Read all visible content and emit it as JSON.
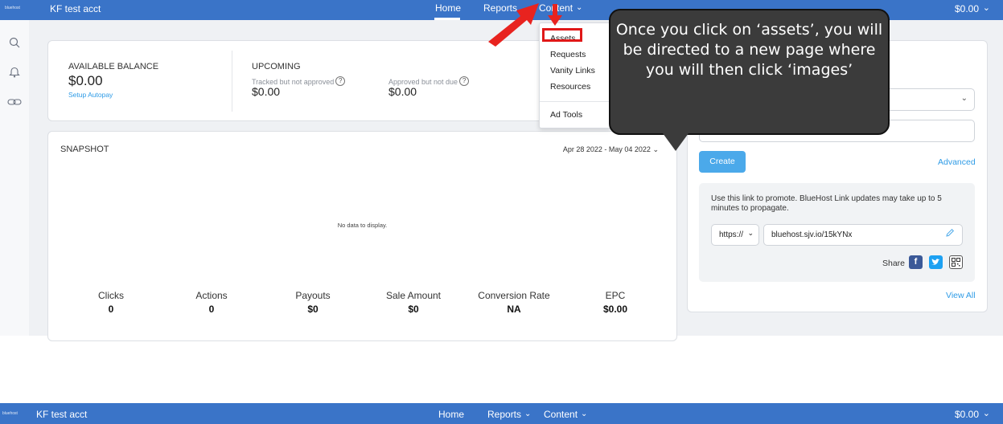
{
  "topbar": {
    "logo_text": "bluehost",
    "account": "KF test acct",
    "nav": [
      "Home",
      "Reports",
      "Content"
    ],
    "balance": "$0.00"
  },
  "balance_card": {
    "available_label": "AVAILABLE BALANCE",
    "available_value": "$0.00",
    "autopay_link": "Setup Autopay",
    "upcoming_label": "UPCOMING",
    "tracked_label": "Tracked but not approved",
    "tracked_value": "$0.00",
    "approved_label": "Approved but not due",
    "approved_value": "$0.00"
  },
  "snapshot": {
    "title": "SNAPSHOT",
    "date_range": "Apr 28 2022 - May 04 2022",
    "empty_message": "No data to display.",
    "stats": [
      {
        "label": "Clicks",
        "value": "0"
      },
      {
        "label": "Actions",
        "value": "0"
      },
      {
        "label": "Payouts",
        "value": "$0"
      },
      {
        "label": "Sale Amount",
        "value": "$0"
      },
      {
        "label": "Conversion Rate",
        "value": "NA"
      },
      {
        "label": "EPC",
        "value": "$0.00"
      }
    ]
  },
  "content_menu": {
    "items": [
      "Assets",
      "Requests",
      "Vanity Links",
      "Resources"
    ],
    "ad_tools": "Ad Tools"
  },
  "callout": {
    "text": "Once you click on ‘assets’, you will be directed to a new page where you will then click ‘images’"
  },
  "link_panel": {
    "create_button": "Create",
    "advanced_link": "Advanced",
    "promo_text": "Use this link to promote. BlueHost Link updates may take up to 5 minutes to propagate.",
    "protocol": "https://",
    "link_value": "bluehost.sjv.io/15kYNx",
    "share_label": "Share",
    "view_all": "View All"
  },
  "bottombar": {
    "logo_text": "bluehost",
    "account": "KF test acct",
    "nav": [
      "Home",
      "Reports",
      "Content"
    ],
    "balance": "$0.00"
  },
  "colors": {
    "topbar": "#3a74c8",
    "accent": "#4ba9ea",
    "highlight": "#e01818",
    "arrow": "#e8231f",
    "callout": "#3b3b3b"
  }
}
